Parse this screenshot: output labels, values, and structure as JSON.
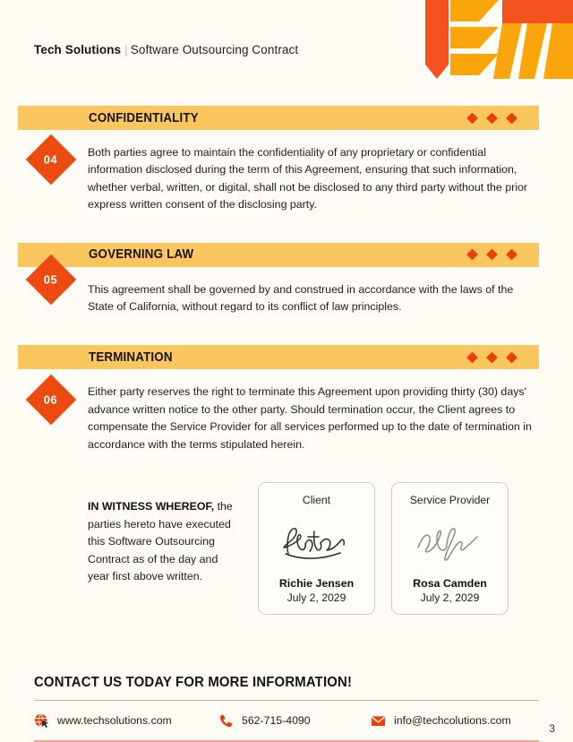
{
  "header": {
    "brand": "Tech Solutions",
    "divider": "|",
    "subtitle": "Software Outsourcing Contract",
    "logo_icon": "tech-solutions-logo"
  },
  "colors": {
    "page_background": "#fffbf5",
    "bar_background": "#fcc65f",
    "badge": "#ec4a11",
    "accent_orange": "#e8400e",
    "logo_orange": "#f4521f",
    "logo_amber": "#f9a50b",
    "footer_rule": "#f0a58a",
    "card_border": "#c9cfd6"
  },
  "sections": [
    {
      "number": "04",
      "title": "CONFIDENTIALITY",
      "body": "Both parties agree to maintain the confidentiality of any proprietary or confidential information disclosed during the term of this Agreement, ensuring that such information, whether verbal, written, or digital, shall not be disclosed to any third party without the prior express written consent of the disclosing party."
    },
    {
      "number": "05",
      "title": "GOVERNING LAW",
      "body": "This agreement shall be governed by and construed in accordance with the laws of the State of California, without regard to its conflict of law principles."
    },
    {
      "number": "06",
      "title": "TERMINATION",
      "body": "Either party reserves the right to terminate this Agreement upon providing thirty (30) days' advance written notice to the other party. Should termination occur, the Client agrees to compensate the Service Provider for all services performed up to the date of termination in accordance with the terms stipulated herein."
    }
  ],
  "witness": {
    "lead": "IN WITNESS WHEREOF,",
    "rest": " the parties hereto have executed this Software Outsourcing Contract as of the day and year first above written."
  },
  "signatures": [
    {
      "role": "Client",
      "name": "Richie Jensen",
      "date": "July 2, 2029",
      "signature_icon": "handwritten-signature"
    },
    {
      "role": "Service Provider",
      "name": "Rosa Camden",
      "date": "July 2, 2029",
      "signature_icon": "handwritten-signature"
    }
  ],
  "footer": {
    "cta": "CONTACT US TODAY FOR MORE INFORMATION!",
    "contacts": [
      {
        "icon": "globe-cursor-icon",
        "value": "www.techsolutions.com"
      },
      {
        "icon": "phone-icon",
        "value": "562-715-4090"
      },
      {
        "icon": "envelope-icon",
        "value": "info@techcolutions.com"
      }
    ],
    "page_number": "3"
  }
}
